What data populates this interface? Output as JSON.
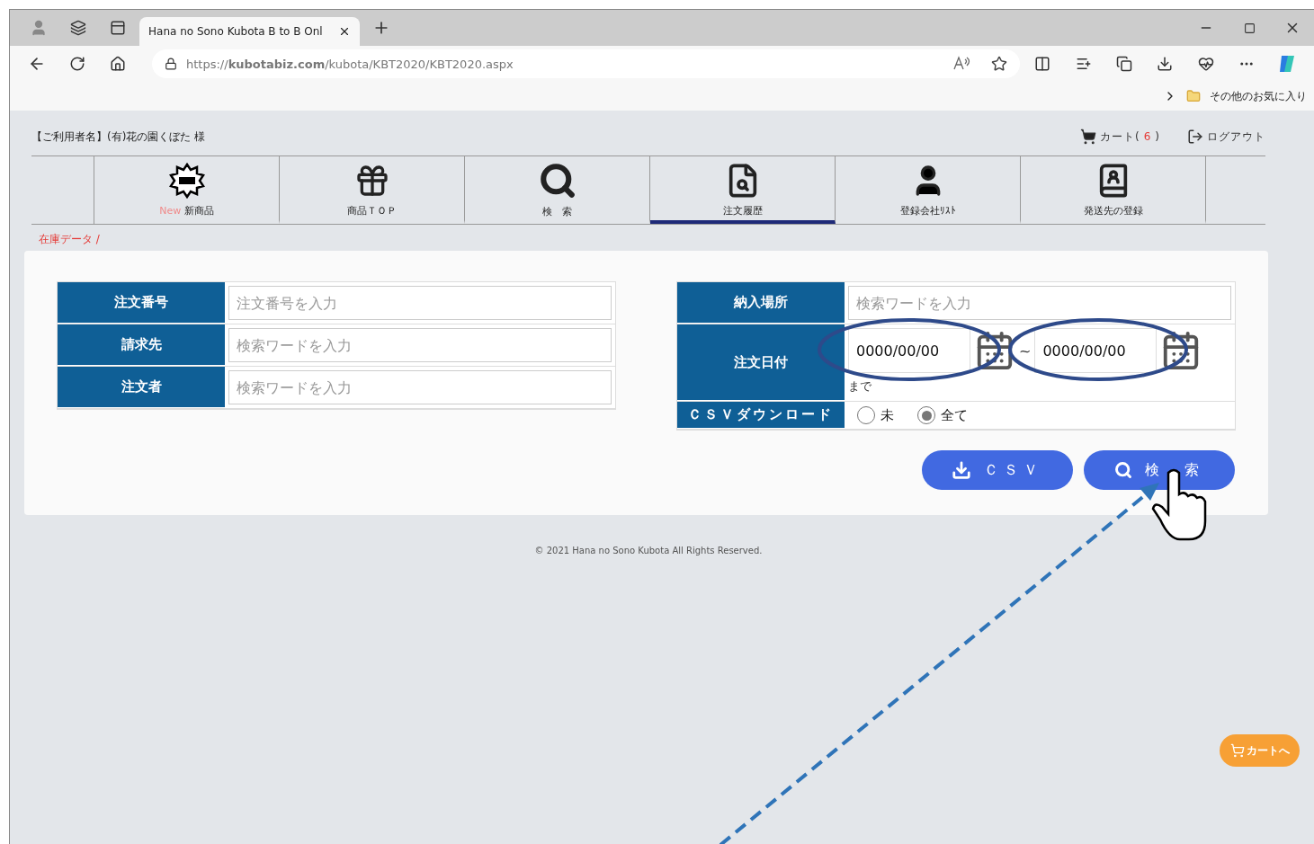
{
  "browser": {
    "tabs": [
      {
        "title": "Hana no Sono Kubota B to B Onl",
        "selected": true
      }
    ],
    "url": "https://**kubotabiz.com**/kubota/KBT2020/KBT2020.aspx",
    "favorites_folder": "その他のお気に入り"
  },
  "header": {
    "user": "【ご利用者名】(有)花の園くぼた 様",
    "cart": "カート(",
    "cart_count": "6",
    "cart_close": ")",
    "logout": "ログアウト"
  },
  "nav": [
    {
      "prefix": "New",
      "label": "新商品",
      "selected": false
    },
    {
      "label": "商品ＴＯＰ",
      "selected": false
    },
    {
      "label": "検　索",
      "selected": false
    },
    {
      "label": "注文履歴",
      "selected": true
    },
    {
      "label": "登録会社ﾘｽﾄ",
      "selected": false
    },
    {
      "label": "発送先の登録",
      "selected": false
    }
  ],
  "breadcrumb": "在庫データ /",
  "left_fields": [
    {
      "label": "注文番号",
      "placeholder": "注文番号を入力"
    },
    {
      "label": "請求先",
      "placeholder": "検索ワードを入力"
    },
    {
      "label": "注文者",
      "placeholder": "検索ワードを入力"
    }
  ],
  "delivery": {
    "label": "納入場所",
    "placeholder": "検索ワードを入力"
  },
  "order_date": {
    "label": "注文日付",
    "from": "0000/00/00",
    "separator": "~",
    "to": "0000/00/00",
    "note": "まで"
  },
  "csv_download": {
    "label": "ＣＳＶダウンロード",
    "options": [
      {
        "label": "未",
        "selected": false
      },
      {
        "label": "全て",
        "selected": true
      }
    ]
  },
  "buttons": [
    {
      "kind": "download",
      "label": "ＣＳＶ"
    },
    {
      "kind": "search",
      "label": "検　索"
    }
  ],
  "footer": "© 2021 Hana no Sono Kubota All Rights Reserved.",
  "floating_cart": "カートへ"
}
